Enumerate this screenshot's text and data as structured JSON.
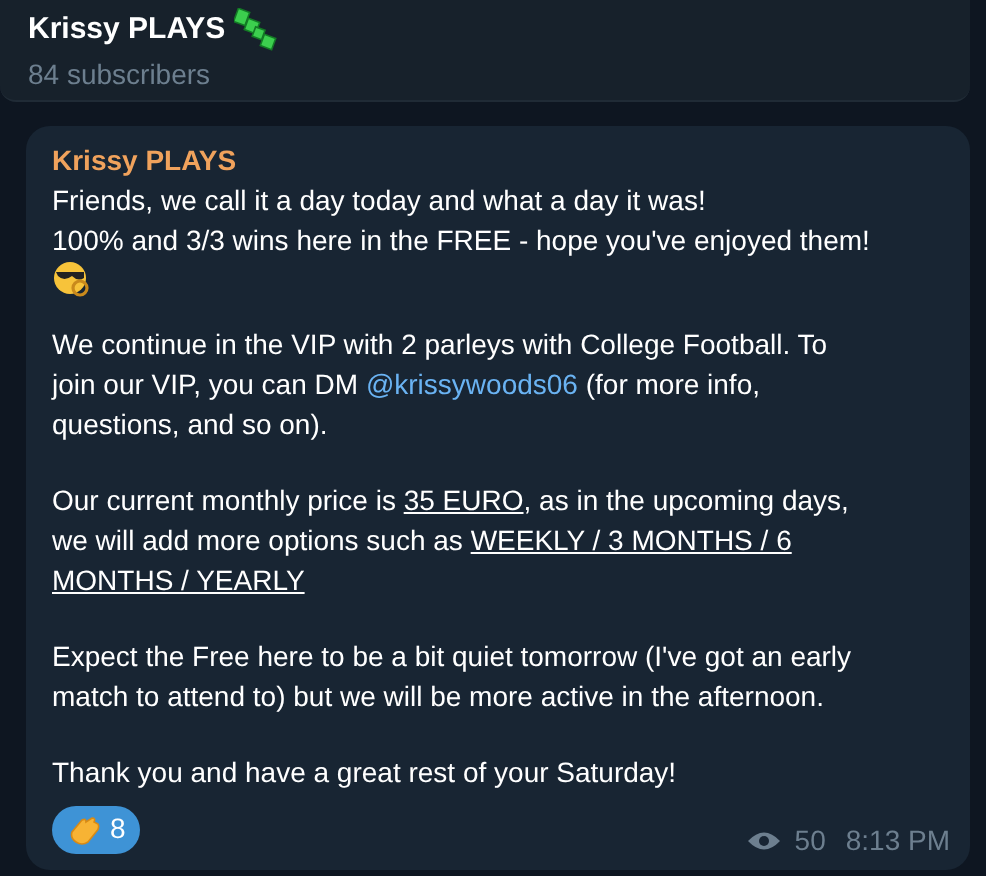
{
  "header": {
    "title": "Krissy PLAYS",
    "subtitle": "84 subscribers"
  },
  "message": {
    "author": "Krissy PLAYS",
    "paragraphs": [
      {
        "segments": [
          {
            "kind": "plain",
            "text": "Friends, we call it a day today and what a day it was!\n100% and 3/3 wins here in the FREE - hope you've enjoyed them!"
          }
        ],
        "emoji": true
      },
      {
        "segments": [
          {
            "kind": "plain",
            "text": "We continue in the VIP with 2 parleys with College Football. To\njoin our VIP, you can DM "
          },
          {
            "kind": "link",
            "text": "@krissywoods06"
          },
          {
            "kind": "plain",
            "text": " (for more info,\nquestions, and so on)."
          }
        ]
      },
      {
        "segments": [
          {
            "kind": "plain",
            "text": "Our current monthly price is "
          },
          {
            "kind": "underline",
            "text": "35 EURO"
          },
          {
            "kind": "plain",
            "text": ", as in the upcoming days,\nwe will add more options such as "
          },
          {
            "kind": "underline",
            "text": "WEEKLY / 3 MONTHS / 6\nMONTHS / YEARLY"
          }
        ]
      },
      {
        "segments": [
          {
            "kind": "plain",
            "text": "Expect the Free here to be a bit quiet tomorrow (I've got an early\nmatch to attend to) but we will be more active in the afternoon."
          }
        ]
      },
      {
        "segments": [
          {
            "kind": "plain",
            "text": "Thank you and have a great rest of your Saturday!"
          }
        ]
      }
    ],
    "reaction": {
      "count": "8",
      "selected": true
    },
    "views": "50",
    "time": "8:13 PM"
  }
}
